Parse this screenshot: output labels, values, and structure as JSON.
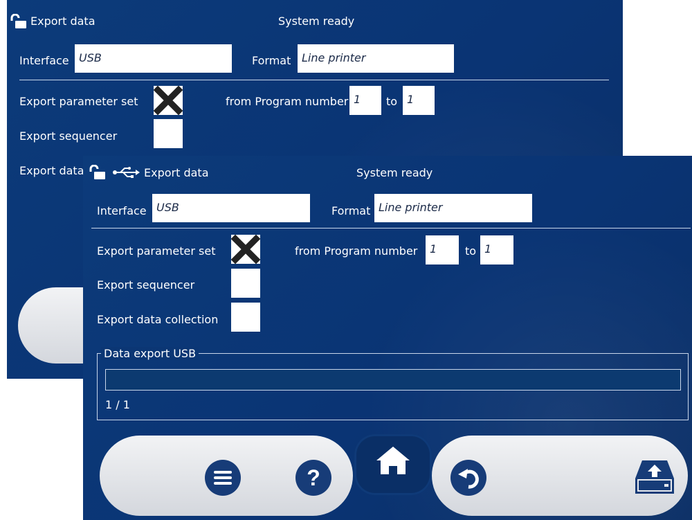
{
  "back": {
    "title": "Export data",
    "status": "System ready",
    "interface_label": "Interface",
    "interface_value": "USB",
    "format_label": "Format",
    "format_value": "Line printer",
    "export_parameter_set_label": "Export parameter set",
    "from_program_label": "from Program number",
    "from_value": "1",
    "to_label": "to",
    "to_value": "1",
    "export_sequencer_label": "Export sequencer",
    "export_data_label_partial": "Export data"
  },
  "front": {
    "title": "Export data",
    "status": "System ready",
    "interface_label": "Interface",
    "interface_value": "USB",
    "format_label": "Format",
    "format_value": "Line printer",
    "export_parameter_set_label": "Export parameter set",
    "export_parameter_set_checked": true,
    "from_program_label": "from Program number",
    "from_value": "1",
    "to_label": "to",
    "to_value": "1",
    "export_sequencer_label": "Export sequencer",
    "export_sequencer_checked": false,
    "export_data_collection_label": "Export data collection",
    "export_data_collection_checked": false,
    "group_title": "Data export USB",
    "progress_text": "1 / 1",
    "progress_fraction": 0
  },
  "toolbar": {
    "icons": [
      "menu-icon",
      "help-icon",
      "home-icon",
      "undo-icon",
      "export-drive-icon"
    ]
  },
  "colors": {
    "panel_bg": "#0a3474",
    "field_bg": "#ffffff",
    "field_text": "#1b2a48",
    "toolbar_bg": "#e4e6ea",
    "icon_fill": "#173c78"
  }
}
